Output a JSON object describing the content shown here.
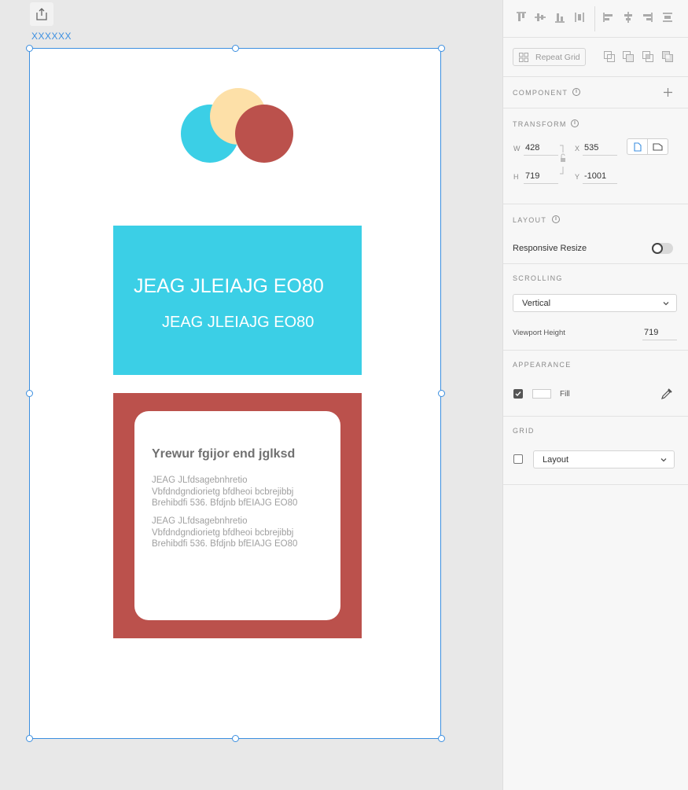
{
  "artboard": {
    "name": "XXXXXX",
    "blue_card": {
      "color": "#3bcfe6",
      "heading": "JEAG JLEIAJG EO80",
      "subheading": "JEAG JLEIAJG EO80"
    },
    "red_card": {
      "color": "#bb514c",
      "title": "Yrewur fgijor end jglksd",
      "paragraphs": [
        [
          "JEAG JLfdsagebnhretio",
          "Vbfdndgndiorietg bfdheoi bcbrejibbj",
          "Brehibdfi 536. Bfdjnb bfEIAJG EO80"
        ],
        [
          "JEAG JLfdsagebnhretio",
          "Vbfdndgndiorietg bfdheoi bcbrejibbj",
          "Brehibdfi 536. Bfdjnb bfEIAJG EO80"
        ]
      ]
    },
    "logo_colors": {
      "blue": "#3bcfe6",
      "peach": "#fde0a8",
      "red": "#bb514c"
    }
  },
  "panel": {
    "repeat_grid_label": "Repeat Grid",
    "component": {
      "label": "COMPONENT"
    },
    "transform": {
      "label": "TRANSFORM",
      "w_label": "W",
      "w": "428",
      "x_label": "X",
      "x": "535",
      "h_label": "H",
      "h": "719",
      "y_label": "Y",
      "y": "-1001"
    },
    "layout": {
      "label": "LAYOUT",
      "responsive_resize_label": "Responsive Resize",
      "responsive_resize_on": false
    },
    "scrolling": {
      "label": "SCROLLING",
      "mode": "Vertical",
      "viewport_height_label": "Viewport Height",
      "viewport_height": "719"
    },
    "appearance": {
      "label": "APPEARANCE",
      "fill_label": "Fill",
      "fill_enabled": true,
      "fill_color": "#ffffff"
    },
    "grid": {
      "label": "GRID",
      "mode": "Layout",
      "enabled": false
    }
  }
}
